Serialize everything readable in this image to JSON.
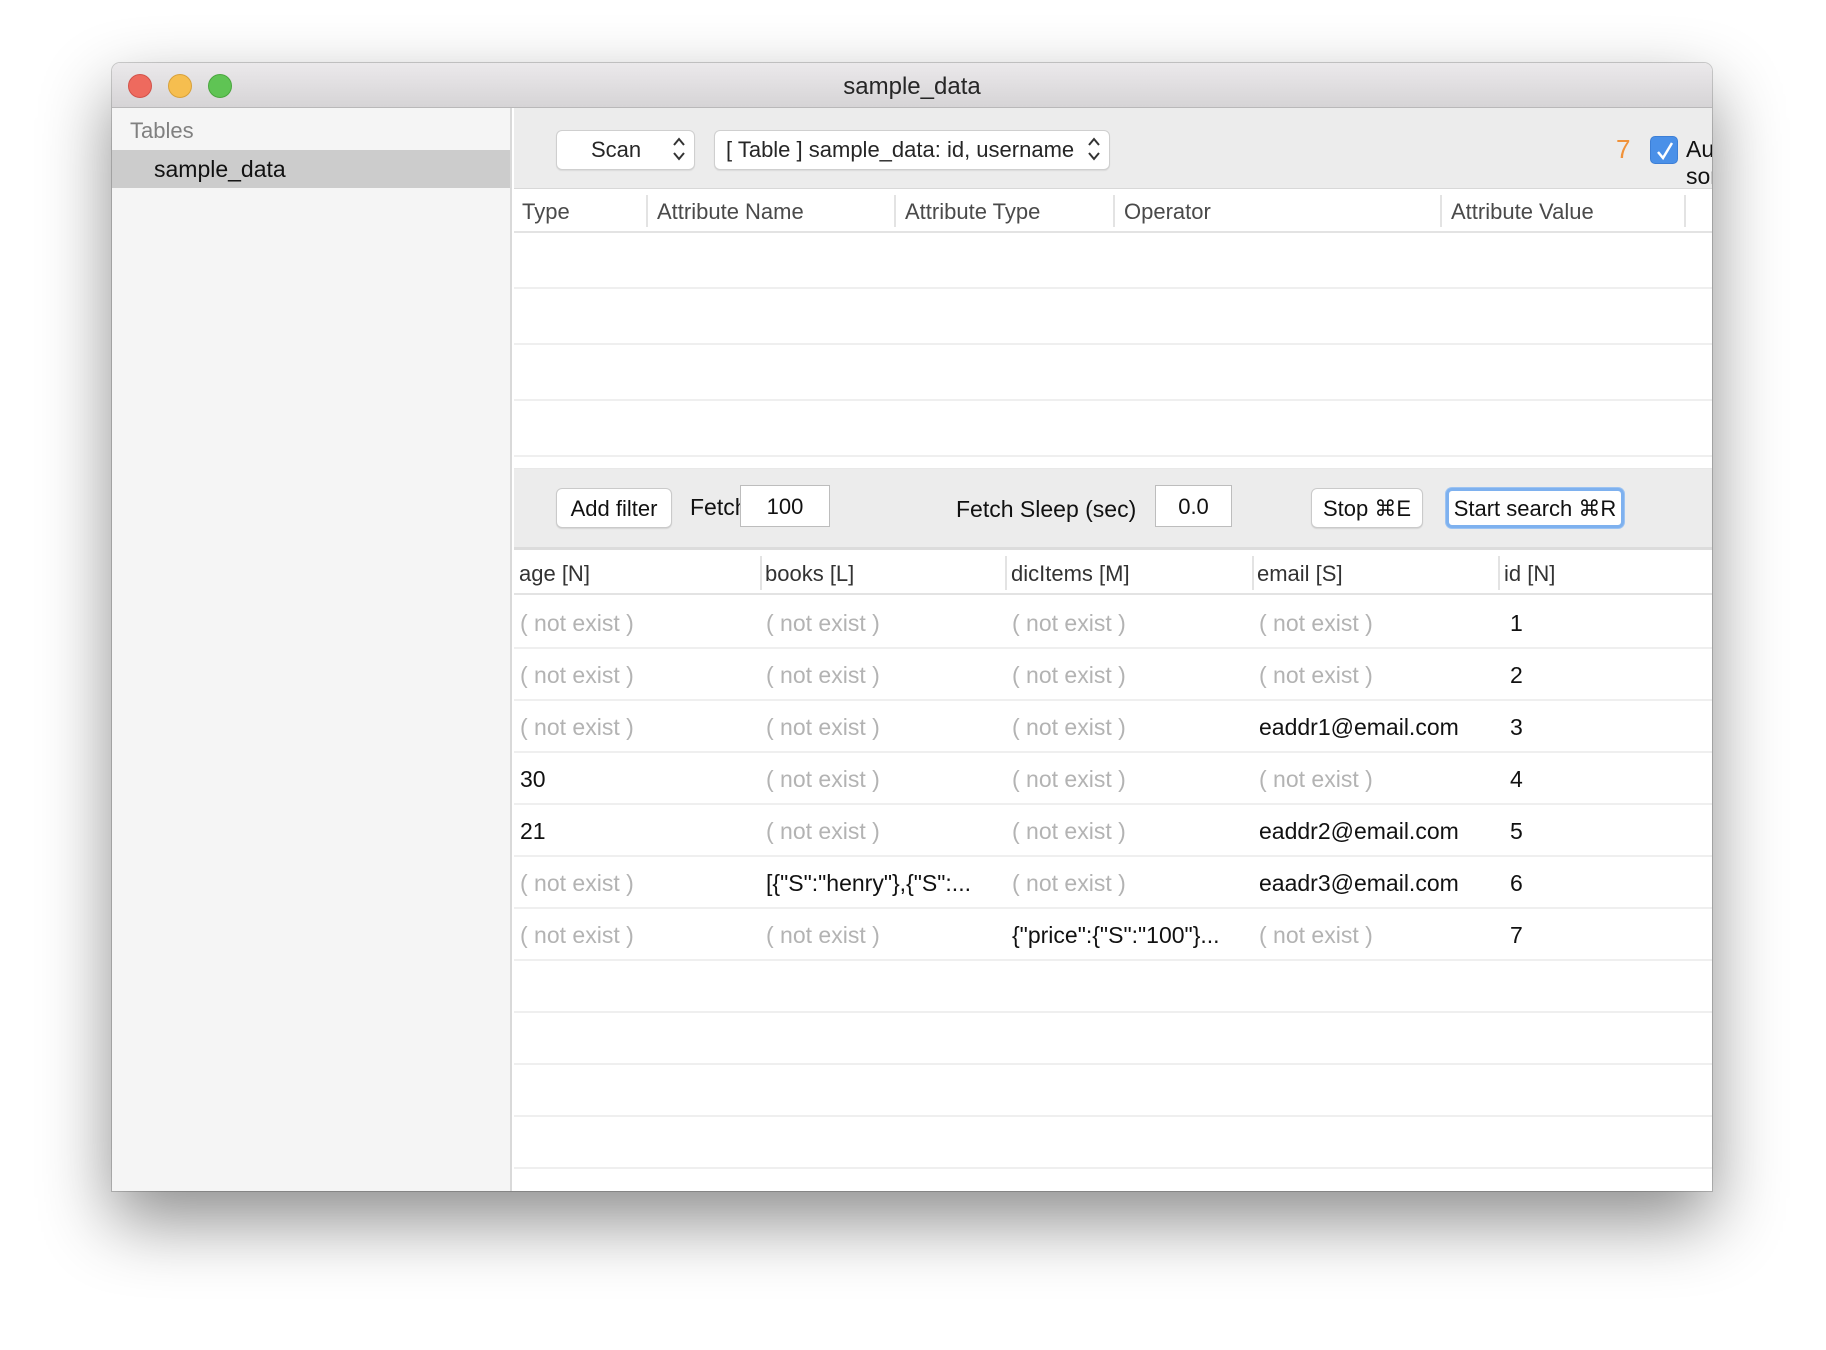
{
  "window": {
    "title": "sample_data"
  },
  "sidebar": {
    "header": "Tables",
    "items": [
      {
        "label": "sample_data",
        "selected": true
      }
    ]
  },
  "topbar": {
    "mode_select": "Scan",
    "table_select": "[ Table ] sample_data: id, username",
    "result_count": "7",
    "result_count_color": "#F0923A",
    "auto_sort": {
      "label": "Auto sort",
      "checked": true
    }
  },
  "filter_table": {
    "columns": [
      "Type",
      "Attribute Name",
      "Attribute Type",
      "Operator",
      "Attribute Value"
    ],
    "rows": []
  },
  "toolbar": {
    "add_filter": "Add filter",
    "fetch_size_label": "Fetch Size",
    "fetch_size_value": "100",
    "fetch_sleep_label": "Fetch Sleep (sec)",
    "fetch_sleep_value": "0.0",
    "stop": "Stop ⌘E",
    "start_search": "Start search ⌘R"
  },
  "results": {
    "columns": [
      "age [N]",
      "books [L]",
      "dicItems [M]",
      "email [S]",
      "id [N]"
    ],
    "missing_text": "( not exist )",
    "rows": [
      [
        "( not exist )",
        "( not exist )",
        "( not exist )",
        "( not exist )",
        "1"
      ],
      [
        "( not exist )",
        "( not exist )",
        "( not exist )",
        "( not exist )",
        "2"
      ],
      [
        "( not exist )",
        "( not exist )",
        "( not exist )",
        "eaddr1@email.com",
        "3"
      ],
      [
        "30",
        "( not exist )",
        "( not exist )",
        "( not exist )",
        "4"
      ],
      [
        "21",
        "( not exist )",
        "( not exist )",
        "eaddr2@email.com",
        "5"
      ],
      [
        "( not exist )",
        "[{\"S\":\"henry\"},{\"S\":...",
        "( not exist )",
        "eaadr3@email.com",
        "6"
      ],
      [
        "( not exist )",
        "( not exist )",
        "{\"price\":{\"S\":\"100\"}...",
        "( not exist )",
        "7"
      ]
    ]
  }
}
